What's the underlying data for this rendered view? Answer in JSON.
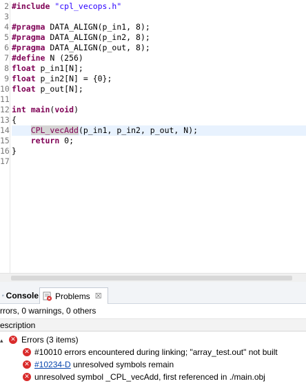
{
  "editor": {
    "lines": [
      {
        "num": "2",
        "tokens": [
          {
            "t": "#include ",
            "c": "kw"
          },
          {
            "t": "\"cpl_vecops.h\"",
            "c": "str"
          }
        ]
      },
      {
        "num": "3",
        "tokens": []
      },
      {
        "num": "4",
        "tokens": [
          {
            "t": "#pragma",
            "c": "kw"
          },
          {
            "t": " DATA_ALIGN(p_in1, 8);",
            "c": ""
          }
        ]
      },
      {
        "num": "5",
        "tokens": [
          {
            "t": "#pragma",
            "c": "kw"
          },
          {
            "t": " DATA_ALIGN(p_in2, 8);",
            "c": ""
          }
        ]
      },
      {
        "num": "6",
        "tokens": [
          {
            "t": "#pragma",
            "c": "kw"
          },
          {
            "t": " DATA_ALIGN(p_out, 8);",
            "c": ""
          }
        ]
      },
      {
        "num": "7",
        "tokens": [
          {
            "t": "#define",
            "c": "kw"
          },
          {
            "t": " N (256)",
            "c": ""
          }
        ]
      },
      {
        "num": "8",
        "tokens": [
          {
            "t": "float",
            "c": "kw"
          },
          {
            "t": " p_in1[N];",
            "c": ""
          }
        ]
      },
      {
        "num": "9",
        "tokens": [
          {
            "t": "float",
            "c": "kw"
          },
          {
            "t": " p_in2[N] = {0};",
            "c": ""
          }
        ]
      },
      {
        "num": "10",
        "tokens": [
          {
            "t": "float",
            "c": "kw"
          },
          {
            "t": " p_out[N];",
            "c": ""
          }
        ]
      },
      {
        "num": "11",
        "tokens": []
      },
      {
        "num": "12",
        "tokens": [
          {
            "t": "int",
            "c": "kw"
          },
          {
            "t": " ",
            "c": ""
          },
          {
            "t": "main",
            "c": "kw"
          },
          {
            "t": "(",
            "c": ""
          },
          {
            "t": "void",
            "c": "kw"
          },
          {
            "t": ")",
            "c": ""
          }
        ]
      },
      {
        "num": "13",
        "tokens": [
          {
            "t": "{",
            "c": ""
          }
        ]
      },
      {
        "num": "14",
        "current": true,
        "tokens": [
          {
            "t": "    ",
            "c": ""
          },
          {
            "t": "CPL_vecAdd",
            "c": "fn-hl"
          },
          {
            "t": "(p_in1, p_in2, p_out, N);",
            "c": ""
          }
        ]
      },
      {
        "num": "15",
        "tokens": [
          {
            "t": "    ",
            "c": ""
          },
          {
            "t": "return",
            "c": "kw"
          },
          {
            "t": " 0;",
            "c": ""
          }
        ]
      },
      {
        "num": "16",
        "tokens": [
          {
            "t": "}",
            "c": ""
          }
        ]
      },
      {
        "num": "17",
        "tokens": []
      }
    ]
  },
  "tabs": {
    "console_label": "Console",
    "problems_label": "Problems",
    "close_glyph": "☒"
  },
  "problems": {
    "summary": "rrors, 0 warnings, 0 others",
    "column_description": "escription",
    "group_label": "Errors (3 items)",
    "group_toggle": "▴",
    "items": [
      {
        "link": "",
        "text": "#10010 errors encountered during linking; \"array_test.out\" not built"
      },
      {
        "link": "#10234-D",
        "text": " unresolved symbols remain"
      },
      {
        "link": "",
        "text": "unresolved symbol _CPL_vecAdd, first referenced in ./main.obj"
      }
    ]
  },
  "colors": {
    "keyword": "#7f0055",
    "string": "#2a00ff",
    "current_line": "#e8f2fe",
    "error_icon": "#d92b2b"
  },
  "icons": {
    "error": "error-icon",
    "console": "console-icon",
    "problems": "problems-icon"
  }
}
